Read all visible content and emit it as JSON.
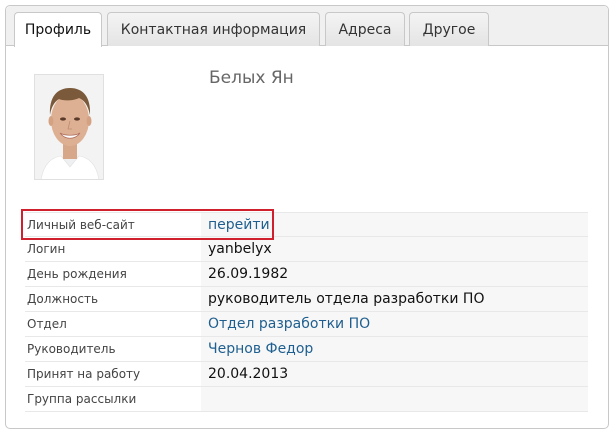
{
  "tabs": [
    {
      "label": "Профиль"
    },
    {
      "label": "Контактная информация"
    },
    {
      "label": "Адреса"
    },
    {
      "label": "Другое"
    }
  ],
  "profile": {
    "name": "Белых Ян",
    "fields": [
      {
        "label": "Личный веб-сайт",
        "value": "перейти"
      },
      {
        "label": "Логин",
        "value": "yanbelyx"
      },
      {
        "label": "День рождения",
        "value": "26.09.1982"
      },
      {
        "label": "Должность",
        "value": "руководитель отдела разработки ПО"
      },
      {
        "label": "Отдел",
        "value": "Отдел разработки ПО"
      },
      {
        "label": "Руководитель",
        "value": "Чернов Федор"
      },
      {
        "label": "Принят на работу",
        "value": "20.04.2013"
      },
      {
        "label": "Группа рассылки",
        "value": ""
      }
    ]
  },
  "colors": {
    "link": "#1f5f8f",
    "highlight": "#d0202e"
  }
}
